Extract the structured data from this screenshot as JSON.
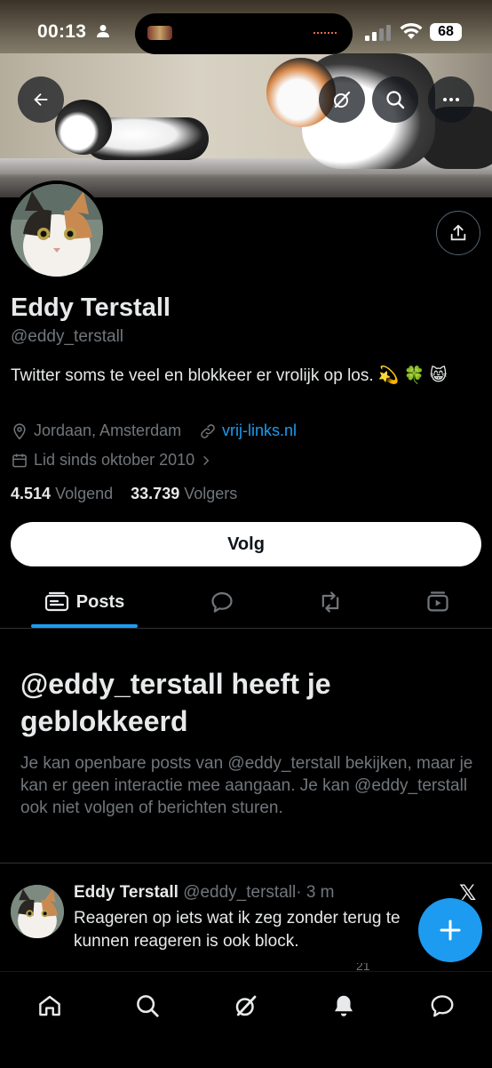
{
  "status_bar": {
    "time": "00:13",
    "battery": "68"
  },
  "profile": {
    "name": "Eddy Terstall",
    "handle": "@eddy_terstall",
    "bio": "Twitter soms te veel en blokkeer er vrolijk op los. 💫 🍀 😸",
    "location": "Jordaan, Amsterdam",
    "website": "vrij-links.nl",
    "joined": "Lid sinds oktober 2010",
    "following_count": "4.514",
    "following_label": "Volgend",
    "followers_count": "33.739",
    "followers_label": "Volgers",
    "follow_button": "Volg"
  },
  "tabs": {
    "posts_label": "Posts",
    "active": "posts"
  },
  "blocked": {
    "title": "@eddy_terstall heeft je geblokkeerd",
    "text": "Je kan openbare posts van @eddy_terstall bekijken, maar je kan er geen interactie mee aangaan. Je kan @eddy_terstall ook niet volgen of berichten sturen."
  },
  "post": {
    "author": "Eddy Terstall",
    "handle": "@eddy_terstall",
    "time": "· 3 m",
    "text": "Reageren op iets wat ik zeg zonder terug te kunnen reageren is ook block.",
    "views": "21"
  },
  "colors": {
    "accent": "#1d9bf0",
    "background": "#000000",
    "secondary_text": "#71767b"
  },
  "icons": {
    "back": "arrow-left-icon",
    "grok": "grok-icon",
    "search": "search-icon",
    "more": "more-icon",
    "share": "share-icon",
    "location": "location-pin-icon",
    "link": "link-icon",
    "calendar": "calendar-icon",
    "posts_tab": "posts-tab-icon",
    "replies_tab": "replies-tab-icon",
    "reposts_tab": "reposts-tab-icon",
    "media_tab": "media-tab-icon",
    "compose": "plus-icon",
    "nav_home": "home-icon",
    "nav_search": "search-icon",
    "nav_grok": "grok-icon",
    "nav_notifications": "bell-icon",
    "nav_messages": "chat-icon"
  }
}
